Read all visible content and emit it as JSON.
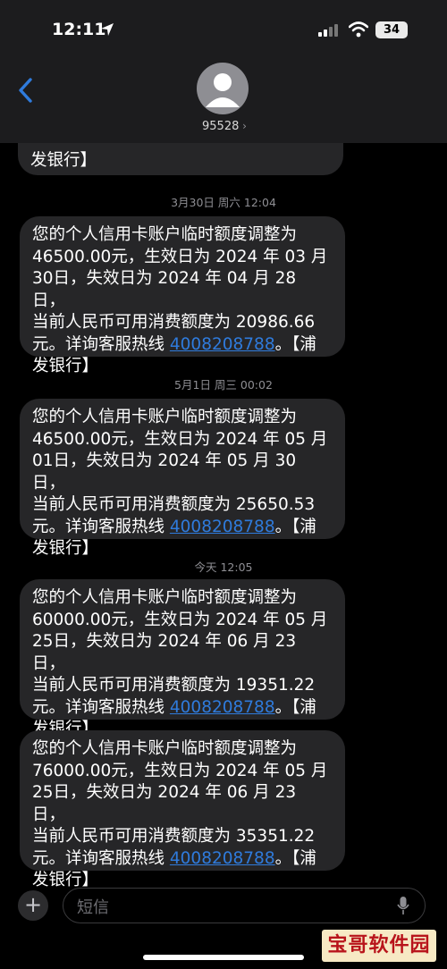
{
  "status_bar": {
    "time": "12:11",
    "battery": "34"
  },
  "header": {
    "contact": "95528"
  },
  "partial_message": {
    "tail": "发银行】"
  },
  "messages": [
    {
      "stamp": "3月30日 周六 12:04",
      "l1": "您的个人信用卡账户临时额度调整为",
      "l2": "46500.00元，生效日为 2024 年 03 月",
      "l3": "30日，失效日为 2024 年 04 月 28 日，",
      "l4": "当前人民币可用消费额度为 20986.66",
      "l5a": "元。详询客服热线 ",
      "phone": "4008208788",
      "l5b": "。【浦",
      "l6": "发银行】"
    },
    {
      "stamp": "5月1日 周三 00:02",
      "l1": "您的个人信用卡账户临时额度调整为",
      "l2": "46500.00元，生效日为 2024 年 05 月",
      "l3": "01日，失效日为 2024 年 05 月 30 日，",
      "l4": "当前人民币可用消费额度为 25650.53",
      "l5a": "元。详询客服热线 ",
      "phone": "4008208788",
      "l5b": "。【浦",
      "l6": "发银行】"
    },
    {
      "stamp": "今天 12:05",
      "l1": "您的个人信用卡账户临时额度调整为",
      "l2": "60000.00元，生效日为 2024 年 05 月",
      "l3": "25日，失效日为 2024 年 06 月 23 日，",
      "l4": "当前人民币可用消费额度为 19351.22",
      "l5a": "元。详询客服热线 ",
      "phone": "4008208788",
      "l5b": "。【浦",
      "l6": "发银行】"
    },
    {
      "stamp": "",
      "l1": "您的个人信用卡账户临时额度调整为",
      "l2": "76000.00元，生效日为 2024 年 05 月",
      "l3": "25日，失效日为 2024 年 06 月 23 日，",
      "l4": "当前人民币可用消费额度为 35351.22",
      "l5a": "元。详询客服热线 ",
      "phone": "4008208788",
      "l5b": "。【浦",
      "l6": "发银行】"
    }
  ],
  "composer": {
    "placeholder": "短信"
  },
  "watermark": {
    "text": "宝哥软件园"
  },
  "colors": {
    "link": "#2f7bdc",
    "bubble": "#262628",
    "header": "#1c1c1e"
  },
  "icons": [
    "location-arrow-icon",
    "cellular-signal-icon",
    "wifi-icon",
    "battery-icon",
    "back-chevron-icon",
    "contact-avatar-icon",
    "plus-icon",
    "microphone-icon"
  ]
}
